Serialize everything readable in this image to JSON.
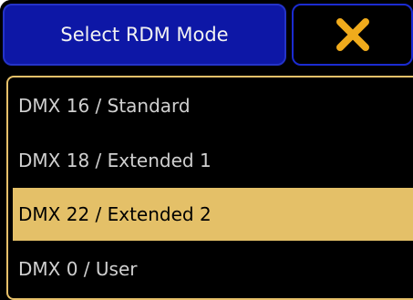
{
  "dialog": {
    "title": "Select RDM Mode",
    "close_icon": "close-x-icon",
    "accent_color": "#e7c16a",
    "title_bg": "#0d17a6"
  },
  "modes": [
    {
      "label": "DMX 16 / Standard",
      "selected": false
    },
    {
      "label": "DMX 18 / Extended 1",
      "selected": false
    },
    {
      "label": "DMX 22 / Extended 2",
      "selected": true
    },
    {
      "label": "DMX 0 / User",
      "selected": false
    }
  ]
}
